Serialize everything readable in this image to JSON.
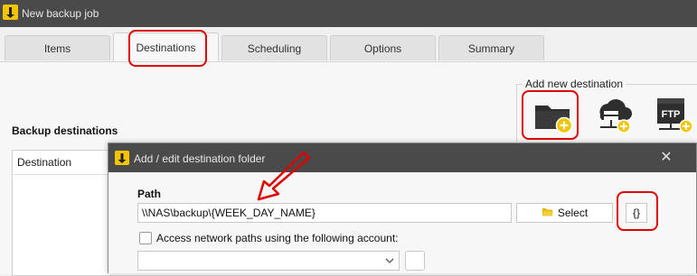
{
  "window": {
    "title": "New backup job"
  },
  "tabs": [
    {
      "label": "Items"
    },
    {
      "label": "Destinations"
    },
    {
      "label": "Scheduling"
    },
    {
      "label": "Options"
    },
    {
      "label": "Summary"
    }
  ],
  "add_destination": {
    "title": "Add new destination",
    "icons": [
      "folder-add-icon",
      "cloud-server-add-icon",
      "ftp-add-icon"
    ],
    "ftp_text": "FTP"
  },
  "backup_destinations": {
    "title": "Backup destinations",
    "column_header": "Destination"
  },
  "dialog": {
    "title": "Add / edit destination folder",
    "path_label": "Path",
    "path_value": "\\\\NAS\\backup\\{WEEK_DAY_NAME}",
    "select_label": "Select",
    "placeholder_button": "{}",
    "checkbox_label": "Access network paths using the following account:",
    "checkbox_checked": false
  },
  "colors": {
    "highlight": "#e00000",
    "accent": "#f5c400",
    "titlebar": "#4a4a4a"
  }
}
